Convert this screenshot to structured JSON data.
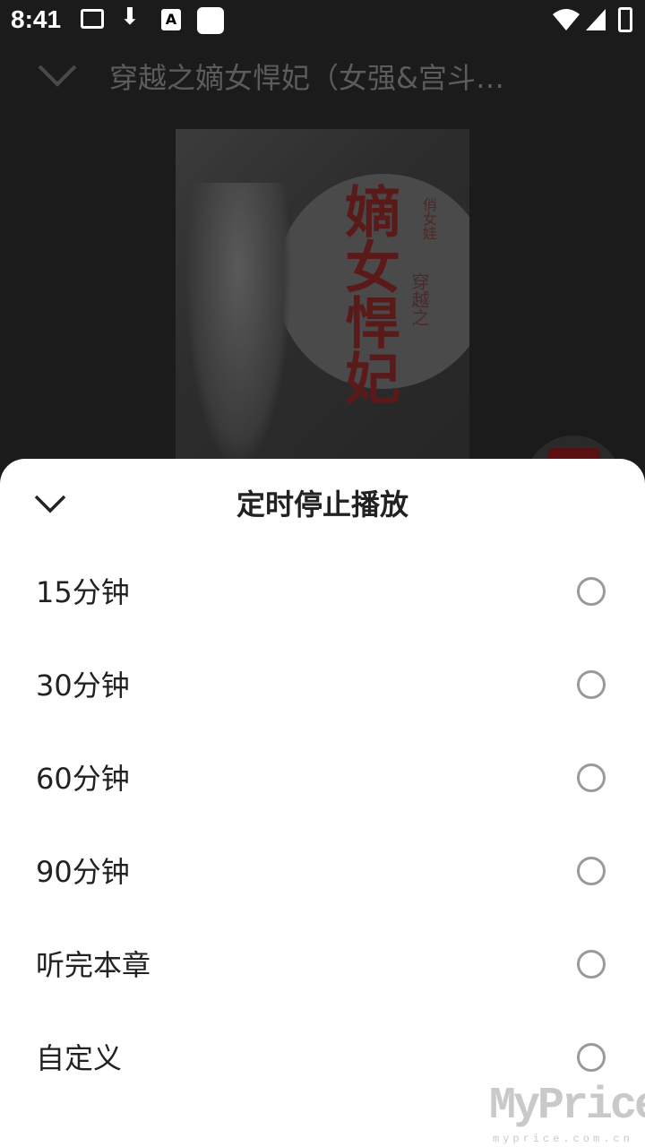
{
  "status_bar": {
    "time": "8:41",
    "a_badge": "A"
  },
  "player": {
    "book_title": "穿越之嫡女悍妃（女强&宫斗…",
    "cover": {
      "title": "嫡女悍妃",
      "subtitle": "穿越之",
      "author": "俏女娃"
    }
  },
  "sheet": {
    "title": "定时停止播放",
    "options": [
      {
        "label": "15分钟",
        "selected": false
      },
      {
        "label": "30分钟",
        "selected": false
      },
      {
        "label": "60分钟",
        "selected": false
      },
      {
        "label": "90分钟",
        "selected": false
      },
      {
        "label": "听完本章",
        "selected": false
      },
      {
        "label": "自定义",
        "selected": false
      }
    ]
  },
  "watermark": {
    "brand": "MyPrice",
    "url": "myprice.com.cn"
  },
  "colors": {
    "sheet_bg": "#ffffff",
    "overlay_bg": "#1b1b1b",
    "radio_border": "#9a9a9a",
    "text_primary": "#222222"
  }
}
